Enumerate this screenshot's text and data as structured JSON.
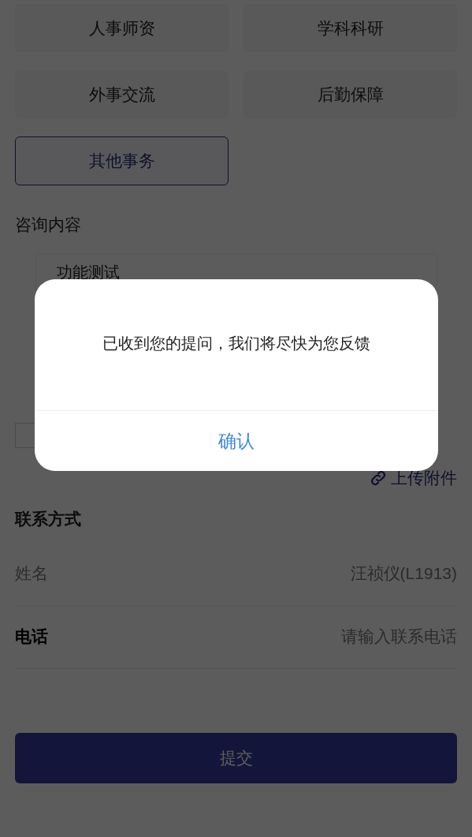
{
  "categories": [
    {
      "label": "人事师资",
      "selected": false
    },
    {
      "label": "学科科研",
      "selected": false
    },
    {
      "label": "外事交流",
      "selected": false
    },
    {
      "label": "后勤保障",
      "selected": false
    },
    {
      "label": "其他事务",
      "selected": true
    }
  ],
  "consult": {
    "title": "咨询内容",
    "value": "功能测试"
  },
  "agreement": {
    "checked": false
  },
  "upload": {
    "label": "上传附件"
  },
  "contact": {
    "title": "联系方式",
    "fields": [
      {
        "label": "姓名",
        "value": "汪祯仪(L1913)",
        "disabled": true
      },
      {
        "label": "电话",
        "placeholder": "请输入联系电话",
        "disabled": false
      }
    ]
  },
  "submit": {
    "label": "提交"
  },
  "dialog": {
    "message": "已收到您的提问，我们将尽快为您反馈",
    "confirm": "确认"
  }
}
